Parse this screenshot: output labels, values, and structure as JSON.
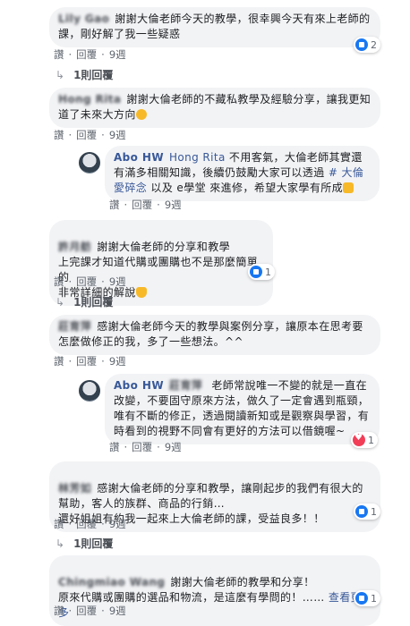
{
  "comments": [
    {
      "author": "Lily Gao",
      "text": "謝謝大倫老師今天的教學，很幸興今天有來上老師的課，剛好解了我一些疑惑",
      "like_label": "讚",
      "reply_label": "回覆",
      "time": "9週",
      "reaction_count": "2",
      "replies": "1則回覆"
    },
    {
      "author": "Hong Rita",
      "text": "謝謝大倫老師的不藏私教學及經驗分享，讓我更知道了未來大方向",
      "like_label": "讚",
      "reply_label": "回覆",
      "time": "9週",
      "reply": {
        "author": "Abo HW",
        "mention": "Hong Rita",
        "text_before": " 不用客氣，大倫老師其實還有滿多相關知識，後續仍鼓勵大家可以透過 ",
        "tag": "# 大倫愛碎念",
        "text_after": " 以及 e學堂 來進修，希望大家學有所成",
        "like_label": "讚",
        "reply_label": "回覆",
        "time": "9週"
      }
    },
    {
      "author": "許月舫",
      "text": "謝謝大倫老師的分享和教學\n上完課才知道代購或團購也不是那麼簡單的\n非常詳細的解說",
      "like_label": "讚",
      "reply_label": "回覆",
      "time": "9週",
      "reaction_count": "1",
      "replies": "1則回覆"
    },
    {
      "author": "莊育萍",
      "text": "感謝大倫老師今天的教學與案例分享，讓原本在思考要怎麼做修正的我，多了一些想法。^^",
      "like_label": "讚",
      "reply_label": "回覆",
      "time": "9週",
      "reply": {
        "author": "Abo HW",
        "mention": "莊育萍",
        "text": " 老師常說唯一不變的就是一直在改變，不要固守原來方法，做久了一定會遇到瓶頸，唯有不斷的修正，透過閱讀新知或是觀察與學習，有時看到的視野不同會有更好的方法可以借鏡喔~",
        "like_label": "讚",
        "reply_label": "回覆",
        "time": "9週",
        "reaction_count": "1"
      }
    },
    {
      "author": "林芳如",
      "text": "感謝大倫老師的分享和教學，讓剛起步的我們有很大的幫助，客人的族群、商品的行銷…\n還好姐姐有約我一起來上大倫老師的課，受益良多！！",
      "like_label": "讚",
      "reply_label": "回覆",
      "time": "9週",
      "reaction_count": "1",
      "replies": "1則回覆"
    },
    {
      "author": "Chingmiao Wang",
      "text": "謝謝大倫老師的教學和分享！\n原來代購或團購的選品和物流，是這麼有學問的！……",
      "see_more": "查看更多",
      "like_label": "讚",
      "reply_label": "回覆",
      "time": "9週",
      "reaction_count": "1"
    }
  ],
  "colors": {
    "link": "#385898",
    "bubble": "#f2f3f5",
    "like": "#1877f2",
    "love": "#f33e58"
  }
}
